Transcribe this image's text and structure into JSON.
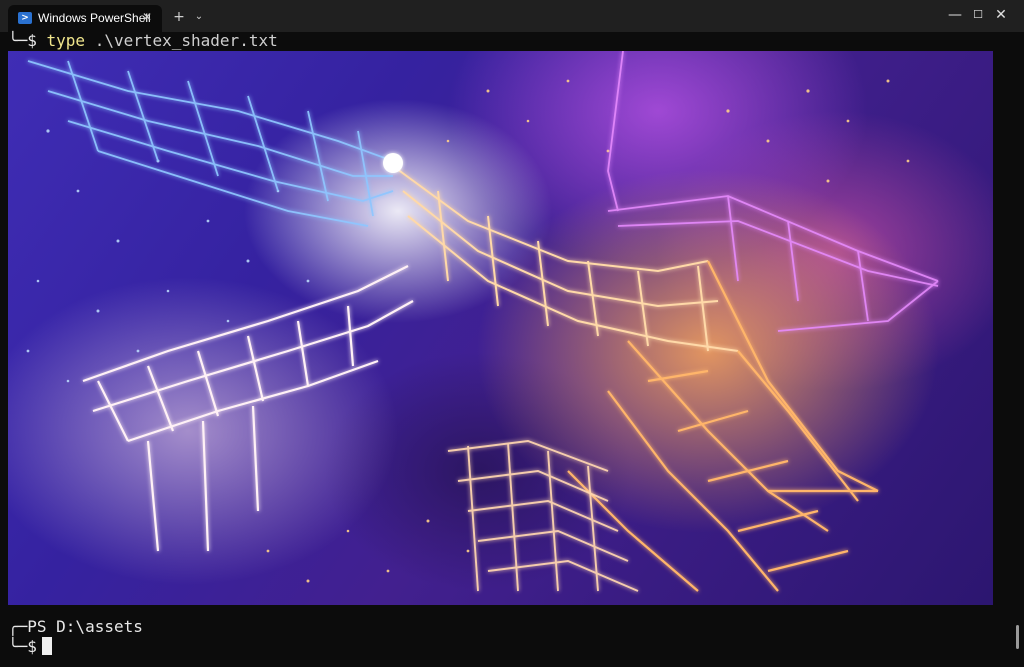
{
  "window": {
    "tab_title": "Windows PowerShell",
    "tab_icon": "powershell-icon",
    "close_tab_glyph": "✕",
    "new_tab_glyph": "+",
    "dropdown_glyph": "⌄",
    "minimize_glyph": "—",
    "maximize_glyph": "☐",
    "close_glyph": "✕"
  },
  "terminal": {
    "line1": {
      "prefix": "╰─$ ",
      "command": "type",
      "argument": " .\\vertex_shader.txt"
    },
    "prompt": {
      "prefix": "╭─",
      "path_text": "PS D:\\assets",
      "symbol_prefix": "╰─$ "
    }
  },
  "image": {
    "description_icon": "wireframe-star-render",
    "colors": {
      "background": "#3522a0",
      "glow_white": "#ffffff",
      "glow_orange": "#ffaa5a",
      "glow_magenta": "#c85af0",
      "glow_blue": "#7fb8ff"
    }
  }
}
